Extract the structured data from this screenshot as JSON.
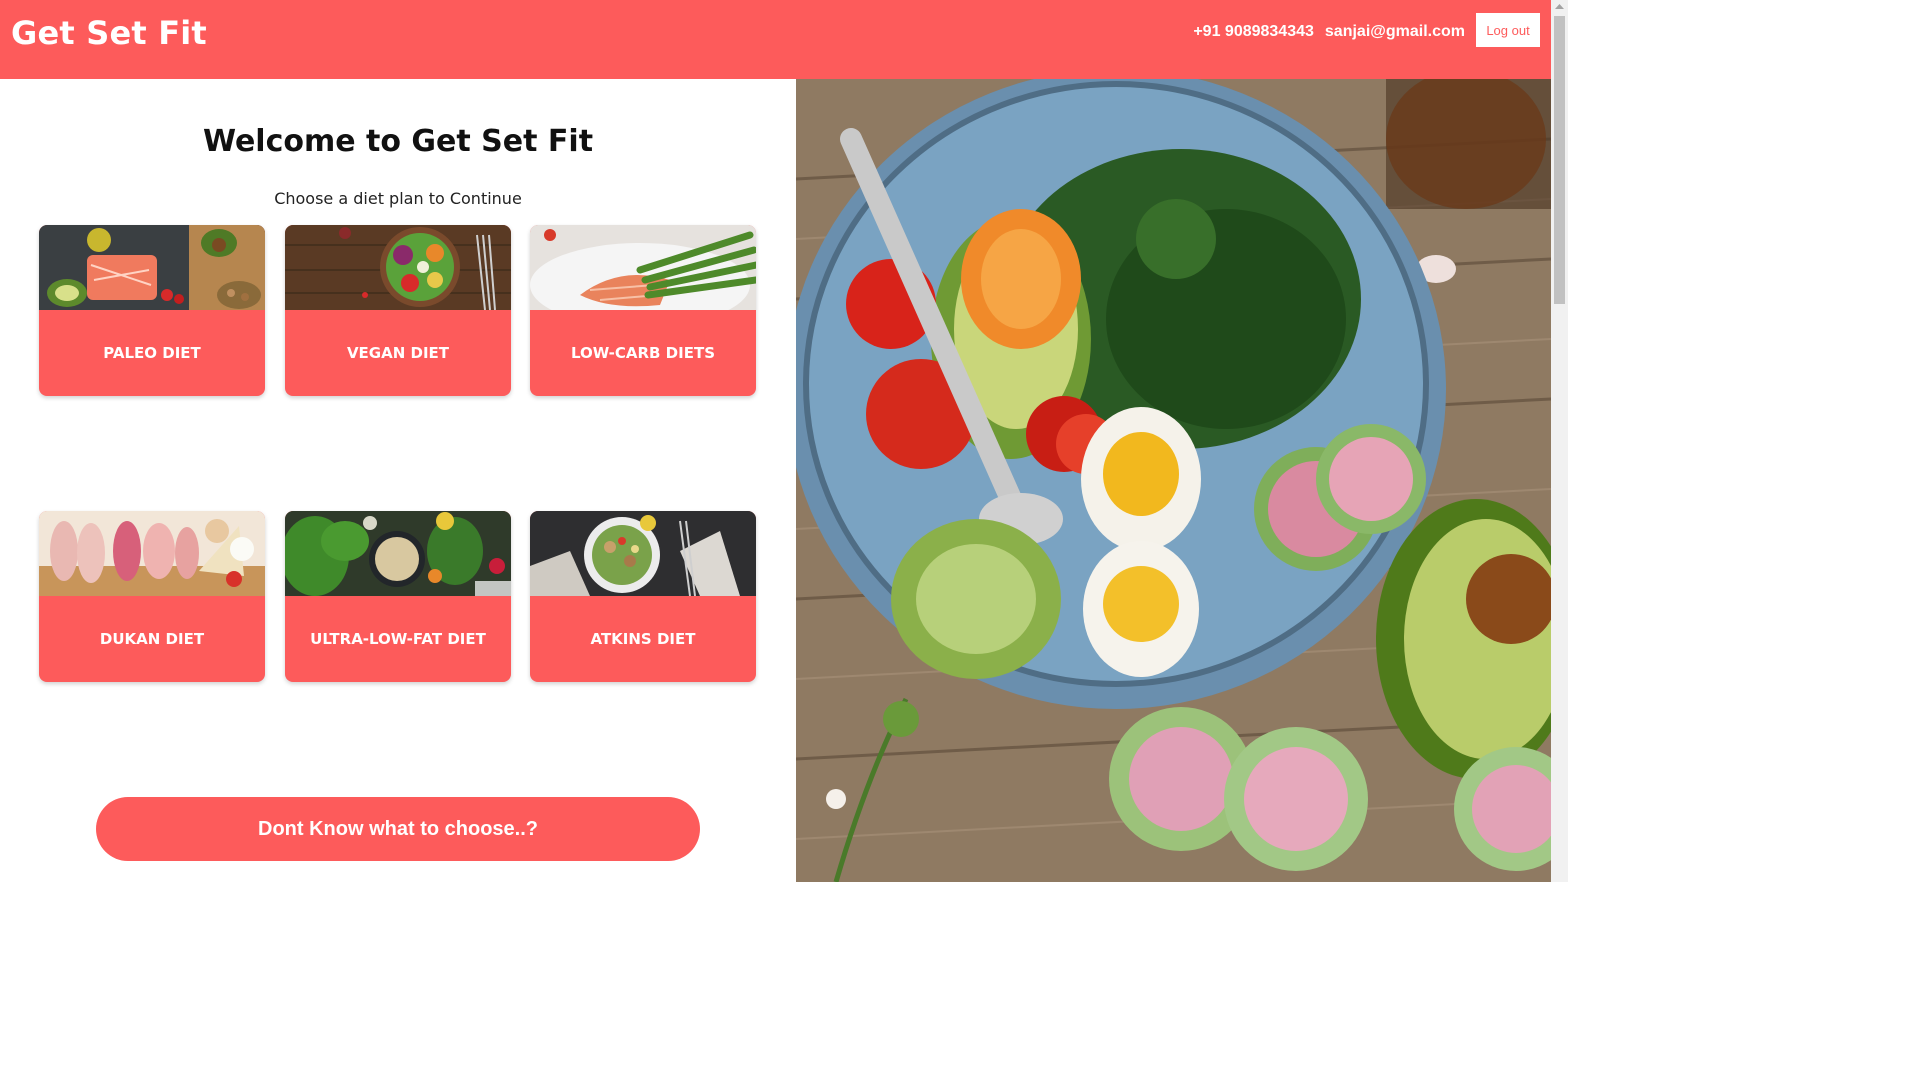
{
  "header": {
    "brand": "Get Set Fit",
    "phone": "+91 9089834343",
    "email": "sanjai@gmail.com",
    "logout_label": "Log out"
  },
  "main": {
    "title": "Welcome to Get Set Fit",
    "subtitle": "Choose a diet plan to Continue",
    "diets": [
      {
        "label": "PALEO DIET",
        "image": "salmon-avocado-nuts-photo"
      },
      {
        "label": "VEGAN DIET",
        "image": "vegetable-bowl-photo"
      },
      {
        "label": "LOW-CARB DIETS",
        "image": "salmon-asparagus-photo"
      },
      {
        "label": "DUKAN DIET",
        "image": "raw-meats-photo"
      },
      {
        "label": "ULTRA-LOW-FAT DIET",
        "image": "grains-vegetables-photo"
      },
      {
        "label": "ATKINS DIET",
        "image": "salad-plate-photo"
      }
    ],
    "choose_button": "Dont Know what to choose..?"
  },
  "hero": {
    "image": "salad-bowl-egg-avocado-photo"
  },
  "colors": {
    "accent": "#fd5b5b",
    "white": "#ffffff"
  }
}
